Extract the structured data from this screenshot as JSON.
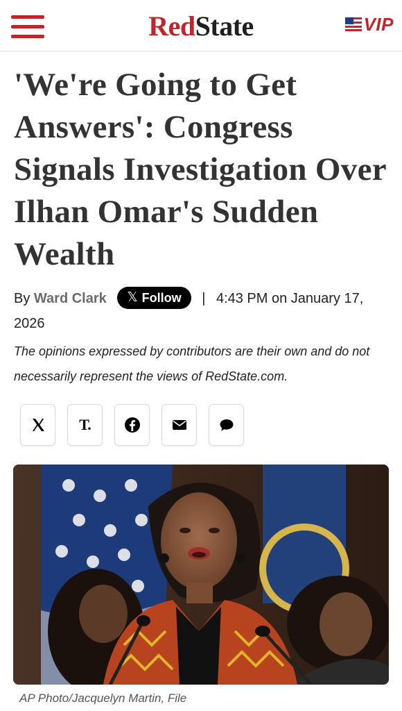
{
  "header": {
    "logo_red": "Red",
    "logo_state": "State",
    "vip_label": "VIP",
    "menu_icon": "hamburger-menu-icon",
    "flag_icon": "us-flag-icon",
    "brand_red": "#c0252c"
  },
  "article": {
    "headline": "'We're Going to Get Answers': Congress Signals Investigation Over Ilhan Omar's Sudden Wealth",
    "byline_prefix": "By",
    "author": "Ward Clark",
    "follow_label": "Follow",
    "separator": "|",
    "timestamp": "4:43 PM on January 17, 2026",
    "disclaimer": "The opinions expressed by contributors are their own and do not necessarily represent the views of RedState.com."
  },
  "share": {
    "buttons": [
      {
        "icon": "x-icon"
      },
      {
        "icon": "truth-social-icon",
        "glyph": "T."
      },
      {
        "icon": "facebook-icon"
      },
      {
        "icon": "email-icon"
      },
      {
        "icon": "comment-icon"
      }
    ]
  },
  "photo": {
    "caption": "AP Photo/Jacquelyn Martin, File"
  }
}
